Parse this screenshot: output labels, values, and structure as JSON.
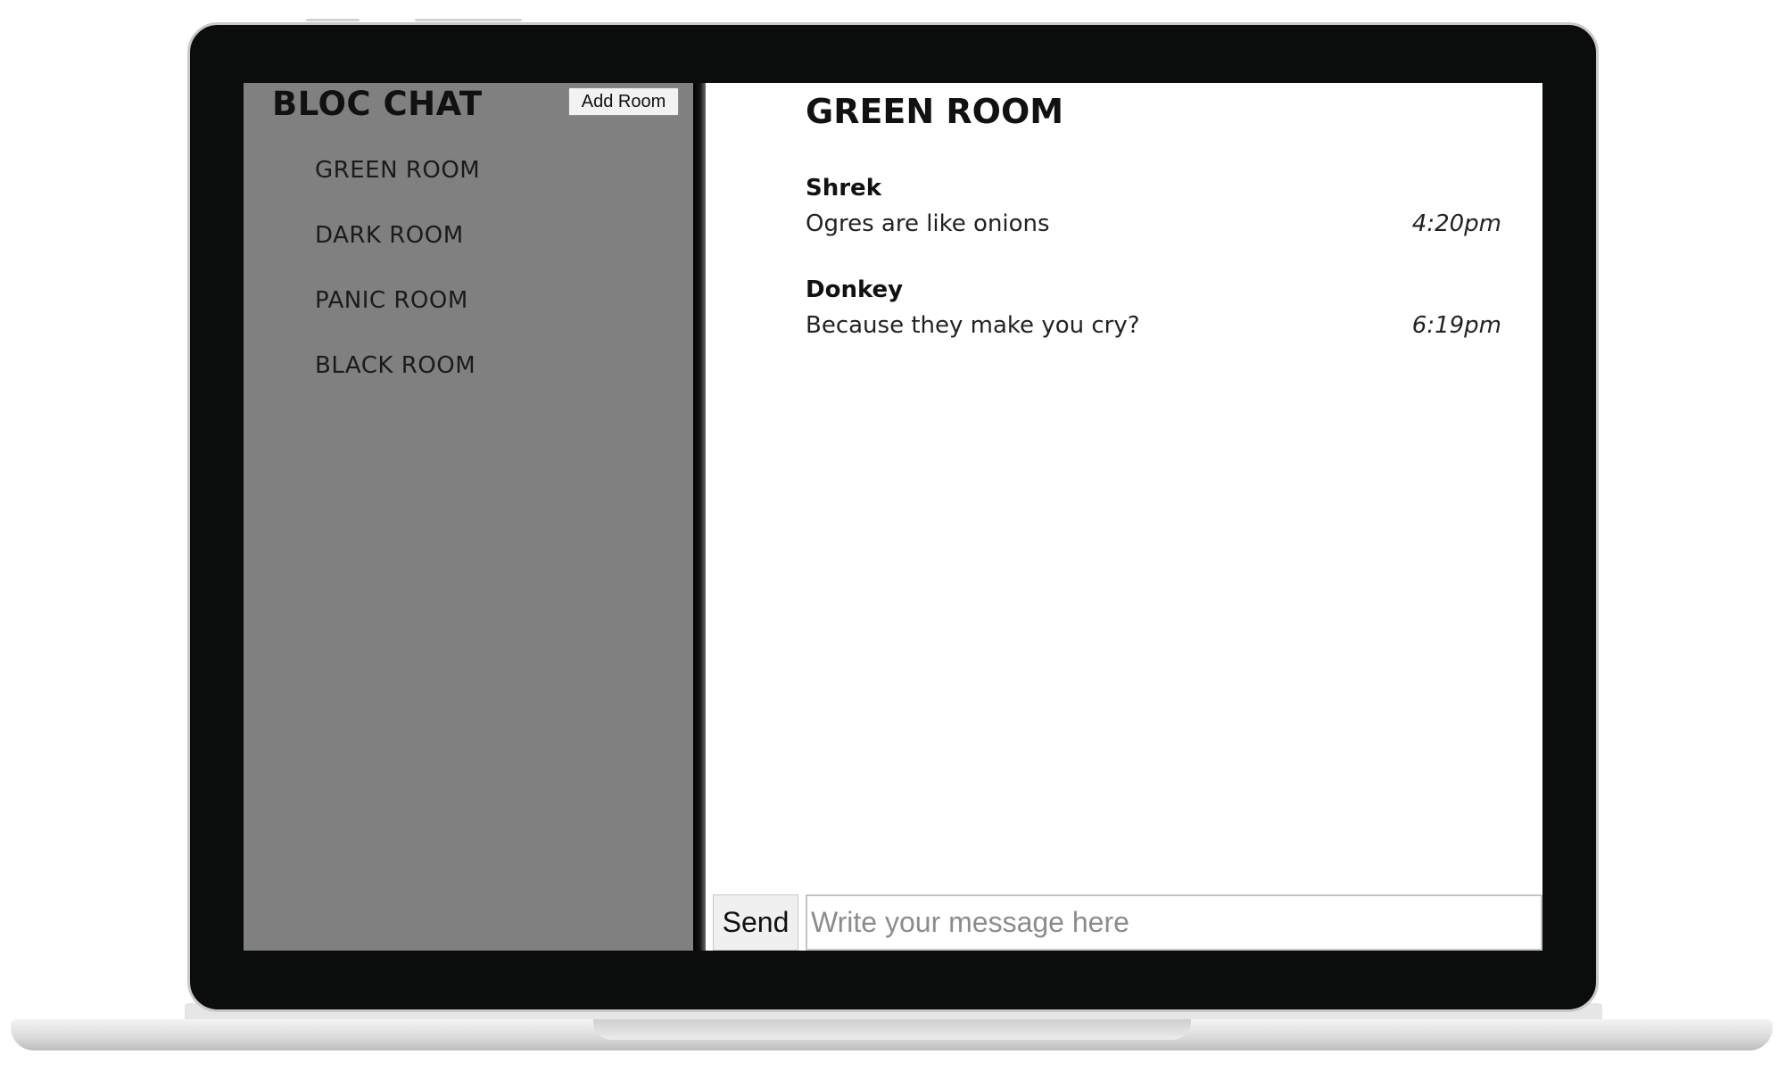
{
  "app": {
    "title": "BLOC CHAT",
    "add_room_label": "Add Room"
  },
  "rooms": [
    {
      "label": "GREEN ROOM"
    },
    {
      "label": "DARK ROOM"
    },
    {
      "label": "PANIC ROOM"
    },
    {
      "label": "BLACK ROOM"
    }
  ],
  "active_room": {
    "title": "GREEN ROOM"
  },
  "messages": [
    {
      "user": "Shrek",
      "text": "Ogres are like onions",
      "time": "4:20pm"
    },
    {
      "user": "Donkey",
      "text": "Because they make you cry?",
      "time": "6:19pm"
    }
  ],
  "composer": {
    "send_label": "Send",
    "placeholder": "Write your message here",
    "value": ""
  },
  "colors": {
    "sidebar": "#808080",
    "bezel": "#0b0d0c",
    "content_bg": "#ffffff"
  }
}
